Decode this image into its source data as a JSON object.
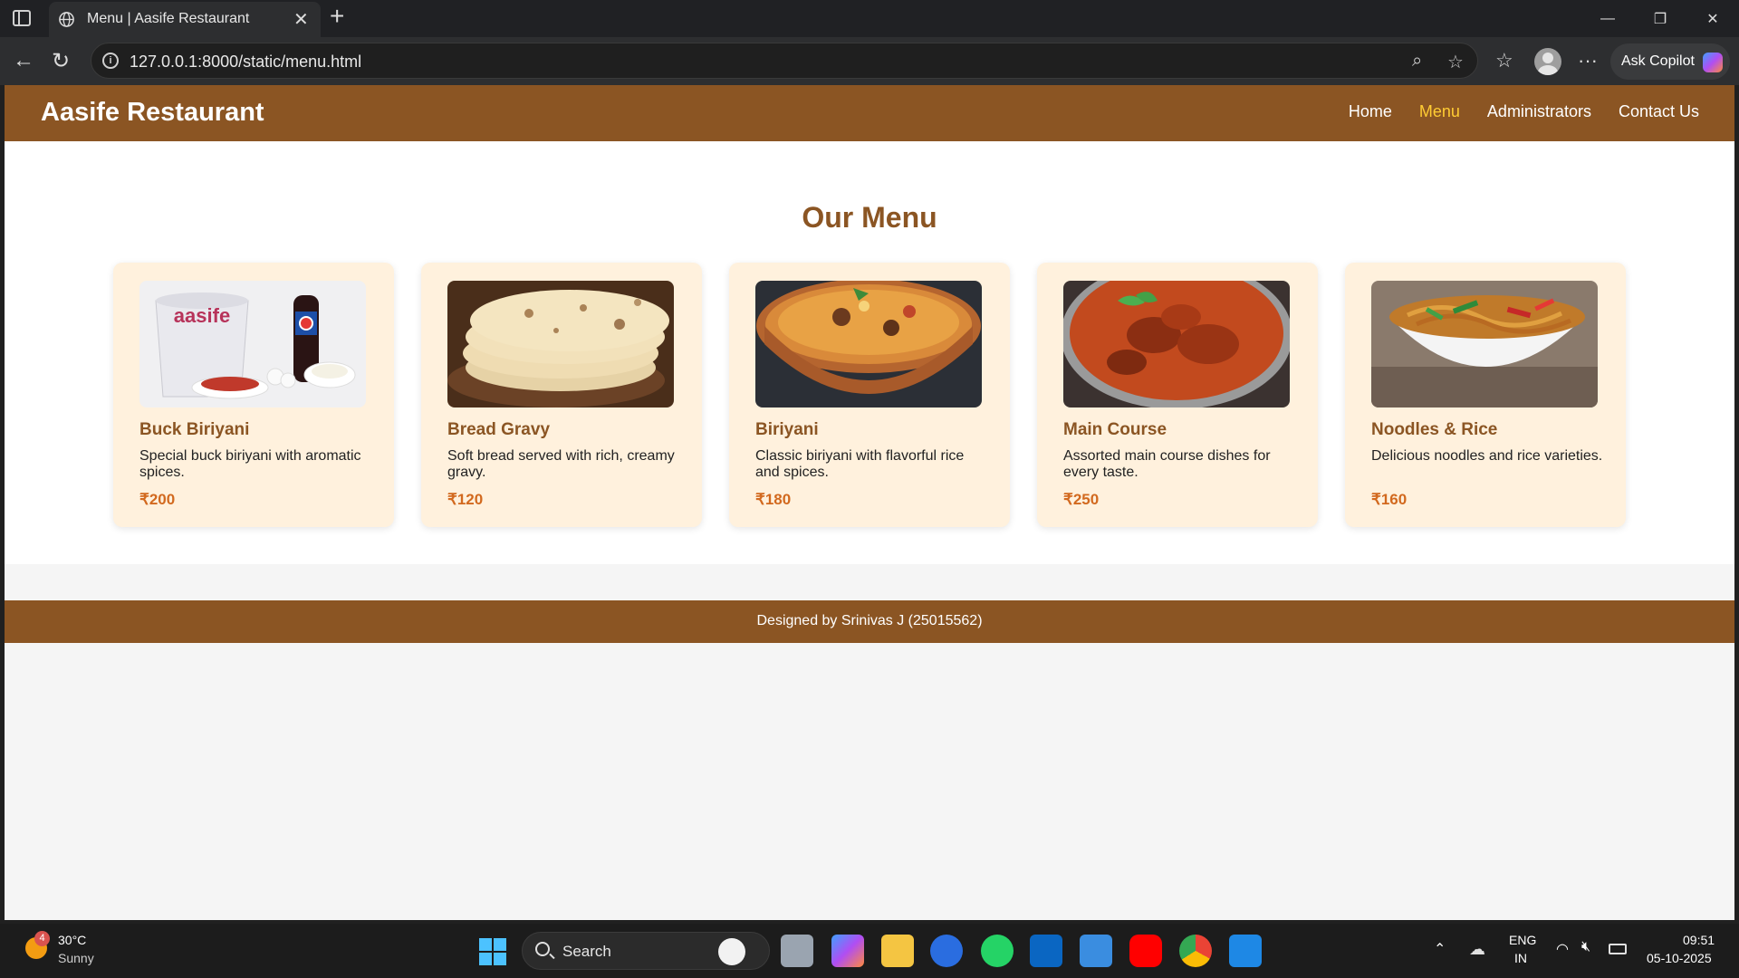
{
  "browser": {
    "tab_title": "Menu | Aasife Restaurant",
    "url": "127.0.0.1:8000/static/menu.html",
    "copilot_label": "Ask Copilot"
  },
  "site": {
    "brand": "Aasife Restaurant",
    "nav": [
      {
        "label": "Home",
        "active": false
      },
      {
        "label": "Menu",
        "active": true
      },
      {
        "label": "Administrators",
        "active": false
      },
      {
        "label": "Contact Us",
        "active": false
      }
    ],
    "menu_title": "Our Menu",
    "items": [
      {
        "name": "Buck Biriyani",
        "description": "Special buck biriyani with aromatic spices.",
        "price": "₹200",
        "image": "combo-bucket-photo"
      },
      {
        "name": "Bread Gravy",
        "description": "Soft bread served with rich, creamy gravy.",
        "price": "₹120",
        "image": "naan-bread-photo"
      },
      {
        "name": "Biriyani",
        "description": "Classic biriyani with flavorful rice and spices.",
        "price": "₹180",
        "image": "biriyani-pot-photo"
      },
      {
        "name": "Main Course",
        "description": "Assorted main course dishes for every taste.",
        "price": "₹250",
        "image": "curry-bowl-photo"
      },
      {
        "name": "Noodles & Rice",
        "description": "Delicious noodles and rice varieties.",
        "price": "₹160",
        "image": "noodles-bowl-photo"
      }
    ],
    "image_logo_text": "aasife",
    "footer": "Designed by Srinivas J (25015562)",
    "colors": {
      "header": "#8b5523",
      "active_nav": "#ffcc33",
      "card_bg": "#fff1dd",
      "price": "#d2691e"
    }
  },
  "taskbar": {
    "weather_badge": "4",
    "temperature": "30°C",
    "condition": "Sunny",
    "search_label": "Search",
    "language": "ENG",
    "region": "IN",
    "time": "09:51",
    "date": "05-10-2025"
  }
}
